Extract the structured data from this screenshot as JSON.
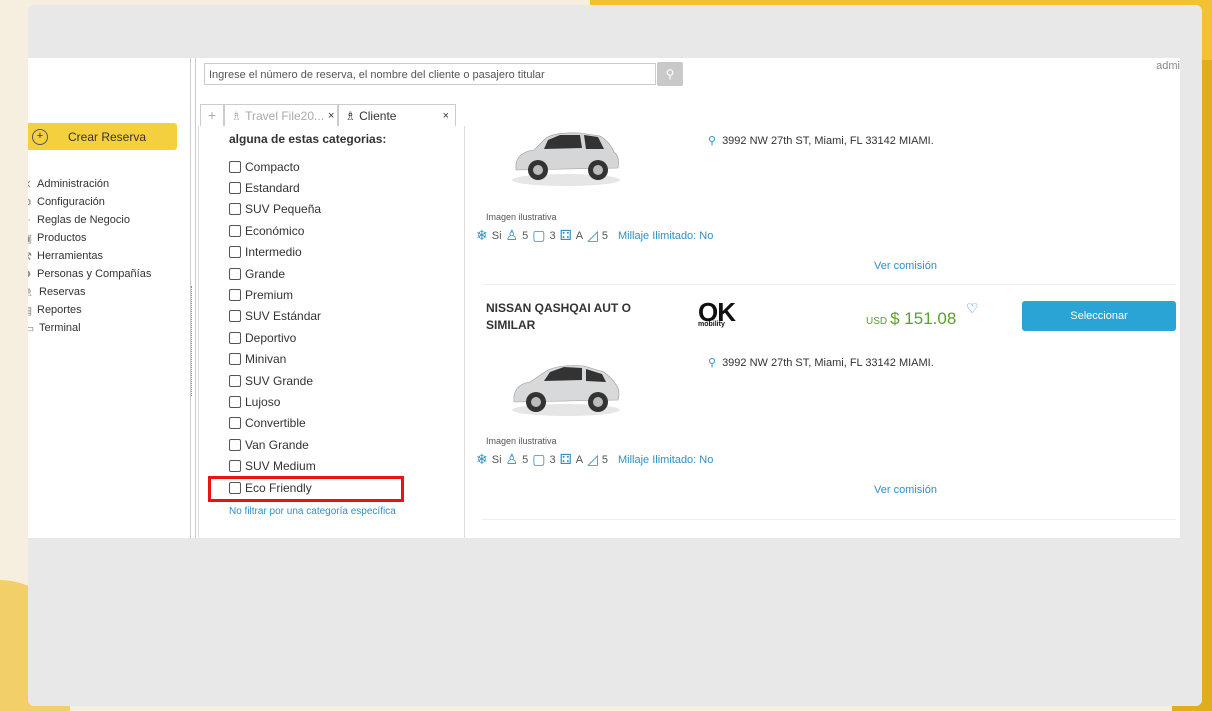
{
  "search": {
    "placeholder": "Ingrese el número de reserva, el nombre del cliente o pasajero titular"
  },
  "user": {
    "label": "admi"
  },
  "sidebar": {
    "create_label": "Crear Reserva",
    "items": [
      {
        "label": "Administración",
        "icon": "tools-icon"
      },
      {
        "label": "Configuración",
        "icon": "gear-icon"
      },
      {
        "label": "Reglas de Negocio",
        "icon": "rules-icon"
      },
      {
        "label": "Productos",
        "icon": "box-icon"
      },
      {
        "label": "Herramientas",
        "icon": "wrench-icon"
      },
      {
        "label": "Personas y Compañías",
        "icon": "people-icon"
      },
      {
        "label": "Reservas",
        "icon": "traveler-icon"
      },
      {
        "label": "Reportes",
        "icon": "report-icon"
      },
      {
        "label": "Terminal",
        "icon": "terminal-icon"
      }
    ]
  },
  "tabs": [
    {
      "label": "Travel File20...",
      "close": "×"
    },
    {
      "label": "Cliente",
      "close": "×"
    }
  ],
  "filter": {
    "heading": "alguna de estas categorias:",
    "categories": [
      "Compacto",
      "Estandard",
      "SUV Pequeña",
      "Económico",
      "Intermedio",
      "Grande",
      "Premium",
      "SUV Estándar",
      "Deportivo",
      "Minivan",
      "SUV Grande",
      "Lujoso",
      "Convertible",
      "Van Grande",
      "SUV Medium",
      "Eco Friendly"
    ],
    "no_filter": "No filtrar por una categoría específica"
  },
  "results": [
    {
      "name": "",
      "address": "3992 NW 27th ST, Miami, FL 33142 MIAMI.",
      "image_note": "Imagen ilustrativa",
      "features": {
        "ac": "Si",
        "passengers": "5",
        "bags": "3",
        "transmission": "A",
        "doors": "5",
        "mileage": "Millaje Ilimitado: No"
      },
      "commission": "Ver comisión"
    },
    {
      "name": "NISSAN QASHQAI AUT O SIMILAR",
      "logo_big": "OK",
      "logo_small": "mobility",
      "currency": "USD",
      "price": "$ 151.08",
      "select": "Seleccionar",
      "address": "3992 NW 27th ST, Miami, FL 33142 MIAMI.",
      "image_note": "Imagen ilustrativa",
      "features": {
        "ac": "Si",
        "passengers": "5",
        "bags": "3",
        "transmission": "A",
        "doors": "5",
        "mileage": "Millaje Ilimitado: No"
      },
      "commission": "Ver comisión"
    }
  ],
  "colors": {
    "accent": "#f4d03f",
    "link": "#2f8fc8",
    "price": "#5aa02c",
    "select": "#2aa4d5",
    "highlight": "#e11111"
  }
}
